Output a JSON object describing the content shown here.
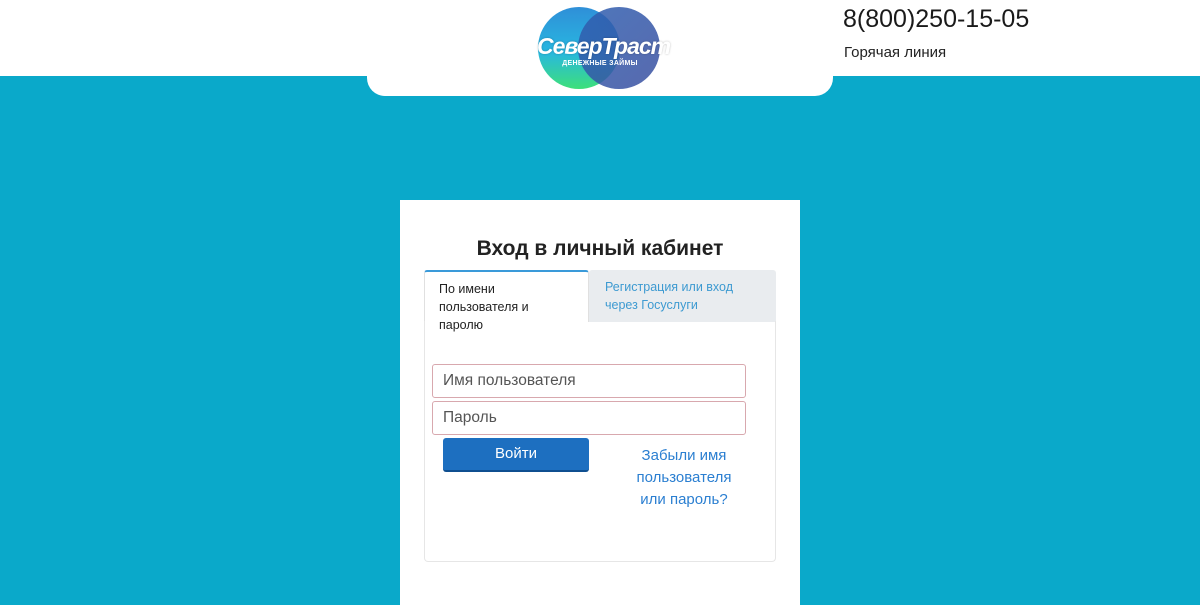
{
  "header": {
    "logo_text": "СеверТраст",
    "logo_subtext": "ДЕНЕЖНЫЕ ЗАЙМЫ",
    "phone": "8(800)250-15-05",
    "hotline_label": "Горячая линия"
  },
  "login": {
    "title": "Вход в личный кабинет",
    "tabs": [
      {
        "label": "По имени пользователя и паролю",
        "active": true
      },
      {
        "label": "Регистрация или вход через Госуслуги",
        "active": false
      }
    ],
    "username_placeholder": "Имя пользователя",
    "password_placeholder": "Пароль",
    "submit_label": "Войти",
    "forgot_link": "Забыли имя пользователя или пароль?"
  },
  "colors": {
    "background": "#0aa9ca",
    "primary_button": "#1d6fc0",
    "link": "#2b7fd1"
  }
}
